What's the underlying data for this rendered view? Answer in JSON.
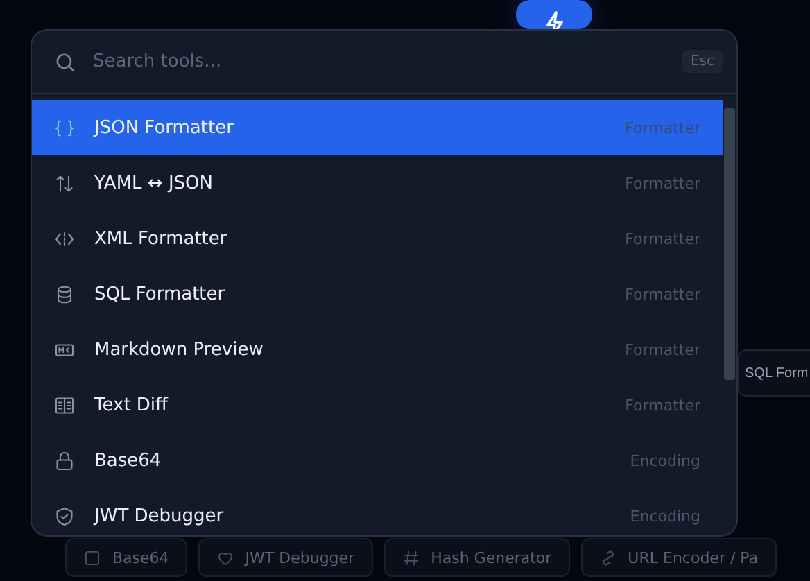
{
  "search": {
    "placeholder": "Search tools...",
    "shortcut": "Esc"
  },
  "tools": [
    {
      "kind": "braces",
      "label": "JSON Formatter",
      "category": "Formatter",
      "selected": true
    },
    {
      "kind": "swap",
      "label": "YAML ↔ JSON",
      "category": "Formatter",
      "selected": false
    },
    {
      "kind": "code",
      "label": "XML Formatter",
      "category": "Formatter",
      "selected": false
    },
    {
      "kind": "database",
      "label": "SQL Formatter",
      "category": "Formatter",
      "selected": false
    },
    {
      "kind": "markdown",
      "label": "Markdown Preview",
      "category": "Formatter",
      "selected": false
    },
    {
      "kind": "columns",
      "label": "Text Diff",
      "category": "Formatter",
      "selected": false
    },
    {
      "kind": "lock",
      "label": "Base64",
      "category": "Encoding",
      "selected": false
    },
    {
      "kind": "shield",
      "label": "JWT Debugger",
      "category": "Encoding",
      "selected": false
    }
  ],
  "background": {
    "side_card": "SQL Form",
    "chips": [
      {
        "kind": "square",
        "label": "Base64"
      },
      {
        "kind": "heart",
        "label": "JWT Debugger"
      },
      {
        "kind": "hash",
        "label": "Hash Generator"
      },
      {
        "kind": "link",
        "label": "URL Encoder / Pa"
      }
    ]
  }
}
